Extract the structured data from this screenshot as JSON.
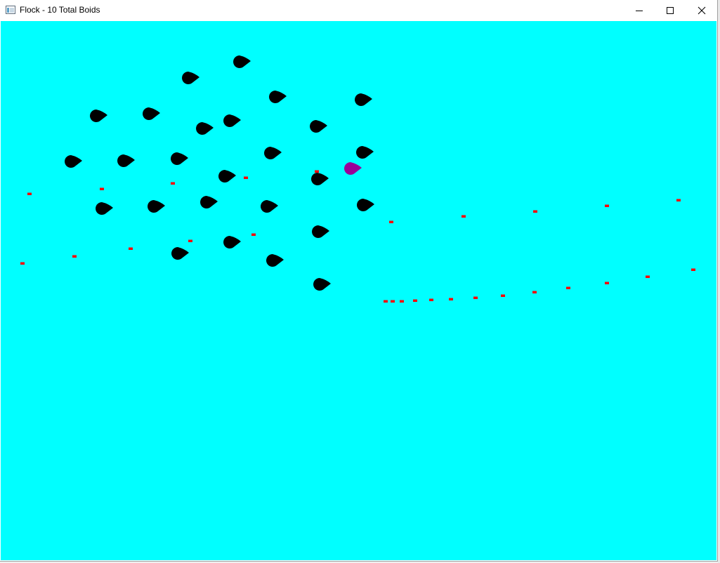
{
  "window": {
    "title": "Flock - 10 Total Boids"
  },
  "icons": {
    "app": "window-icon",
    "minimize": "minimize-icon",
    "maximize": "maximize-icon",
    "close": "close-icon"
  },
  "colors": {
    "background": "#00ffff",
    "boid": "#000000",
    "leader": "#990099",
    "trail": "#ff0000"
  }
}
